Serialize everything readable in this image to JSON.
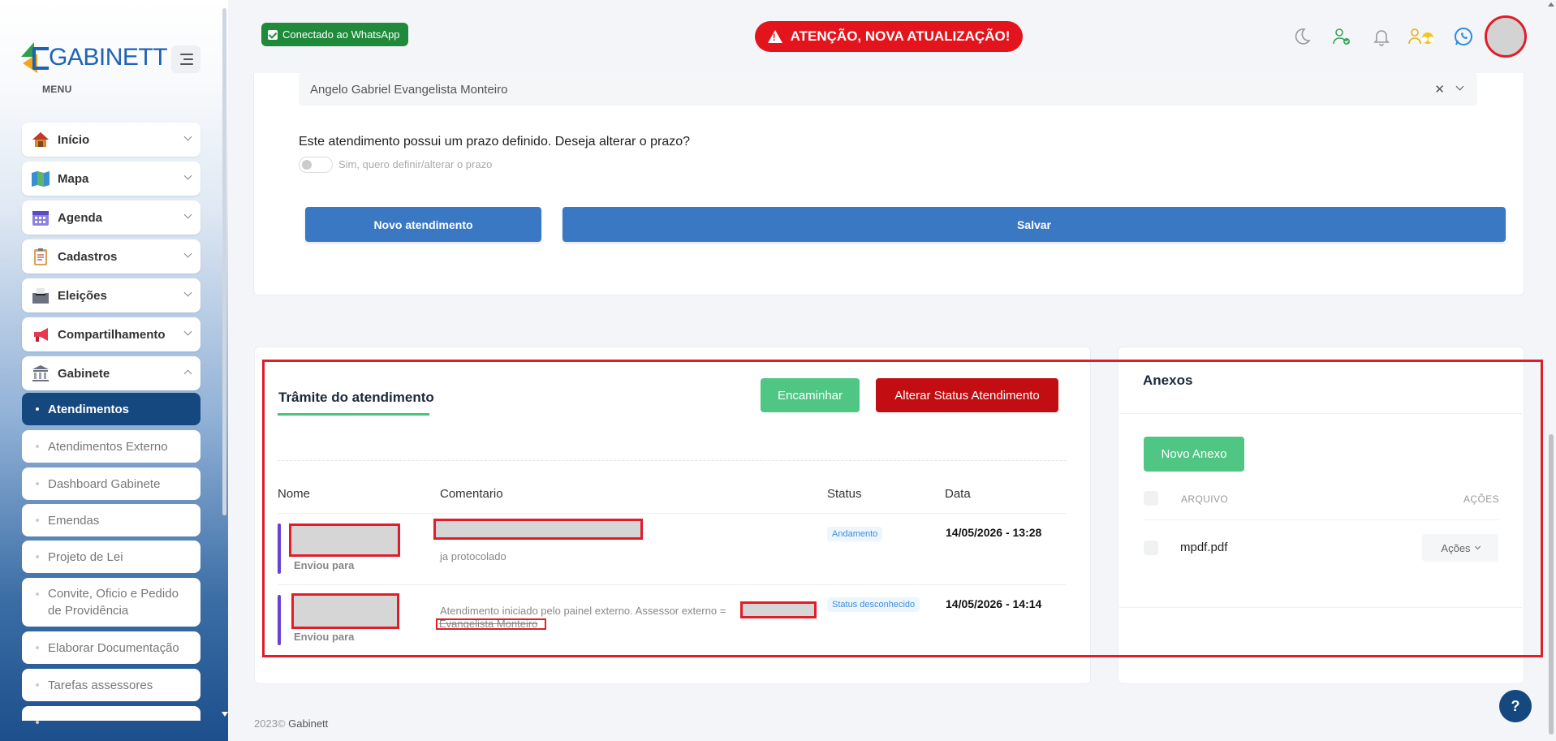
{
  "topbar": {
    "whatsapp_badge": "Conectado ao WhatsApp",
    "alert": "ATENÇÃO, NOVA ATUALIZAÇÃO!"
  },
  "sidebar": {
    "logo_text": "GABINETT",
    "menu_label": "MENU",
    "items": [
      {
        "label": "Início",
        "icon": "home-icon"
      },
      {
        "label": "Mapa",
        "icon": "map-icon"
      },
      {
        "label": "Agenda",
        "icon": "calendar-icon"
      },
      {
        "label": "Cadastros",
        "icon": "clipboard-icon"
      },
      {
        "label": "Eleições",
        "icon": "ballot-box-icon"
      },
      {
        "label": "Compartilhamento",
        "icon": "megaphone-icon"
      },
      {
        "label": "Gabinete",
        "icon": "building-icon"
      }
    ],
    "subitems": [
      "Atendimentos",
      "Atendimentos Externo",
      "Dashboard Gabinete",
      "Emendas",
      "Projeto de Lei",
      "Convite, Oficio e Pedido de Providência",
      "Elaborar Documentação",
      "Tarefas assessores"
    ]
  },
  "form": {
    "assessor_value": "Angelo Gabriel Evangelista Monteiro",
    "question": "Este atendimento possui um prazo definido. Deseja alterar o prazo?",
    "toggle_label": "Sim, quero definir/alterar o prazo",
    "btn_novo": "Novo atendimento",
    "btn_salvar": "Salvar"
  },
  "tramite": {
    "title": "Trâmite do atendimento",
    "btn_encaminhar": "Encaminhar",
    "btn_alterar": "Alterar Status Atendimento",
    "columns": [
      "Nome",
      "Comentario",
      "Status",
      "Data"
    ],
    "rows": [
      {
        "enviou": "Enviou para",
        "comment": "ja protocolado",
        "status": "Andamento",
        "date": "14/05/2026 - 13:28"
      },
      {
        "enviou": "Enviou para",
        "comment": "Atendimento iniciado pelo painel externo. Assessor externo =",
        "comment_tail": "Evangelista Monteiro",
        "status": "Status desconhecido",
        "date": "14/05/2026 - 14:14"
      }
    ]
  },
  "anexos": {
    "title": "Anexos",
    "btn_novo": "Novo Anexo",
    "col_arquivo": "ARQUIVO",
    "col_acoes": "AÇÕES",
    "file": "mpdf.pdf",
    "btn_acoes": "Ações"
  },
  "footer": {
    "year": "2023©",
    "brand": "Gabinett"
  },
  "help_label": "?",
  "colors": {
    "primary": "#3a78c3",
    "sidebar_active": "#14487e",
    "success": "#4fc683",
    "danger": "#c20d12",
    "alert": "#e4141d"
  }
}
